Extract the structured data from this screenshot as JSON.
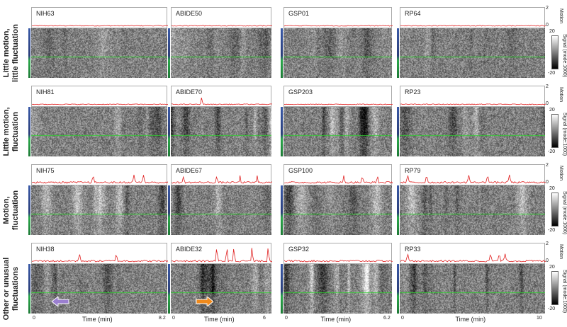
{
  "rows": [
    {
      "label_lines": [
        "Little motion,",
        "little fluctuation"
      ],
      "subjects": [
        "NIH63",
        "ABIDE50",
        "GSP01",
        "RP64"
      ],
      "spikes": [
        [],
        [],
        [],
        []
      ]
    },
    {
      "label_lines": [
        "Little motion,",
        "fluctuation"
      ],
      "subjects": [
        "NIH81",
        "ABIDE70",
        "GSP203",
        "RP23"
      ],
      "spikes": [
        [],
        [
          0.3
        ],
        [],
        []
      ]
    },
    {
      "label_lines": [
        "Motion,",
        "fluctuation"
      ],
      "subjects": [
        "NIH75",
        "ABIDE67",
        "GSP100",
        "RP79"
      ],
      "spikes": [
        [
          0.45,
          0.75,
          0.82
        ],
        [
          0.12,
          0.45,
          0.68,
          0.85
        ],
        [
          0.55,
          0.72,
          0.86
        ],
        [
          0.05,
          0.18,
          0.47,
          0.6,
          0.75
        ]
      ]
    },
    {
      "label_lines": [
        "Other or unusual",
        "fluctuations"
      ],
      "subjects": [
        "NIH38",
        "ABIDE32",
        "GSP32",
        "RP33"
      ],
      "spikes": [
        [
          0.35,
          0.62
        ],
        [
          0.45,
          0.55,
          0.62,
          0.8,
          0.96
        ],
        [],
        [
          0.05,
          0.62,
          0.68,
          0.72
        ]
      ]
    }
  ],
  "motion_axis": {
    "label": "Motion",
    "max": "2",
    "min": "0"
  },
  "signal_axis": {
    "label": "Signal (mode:1000)",
    "max": "20",
    "min": "-20"
  },
  "time_axis": {
    "label": "Time (min)",
    "ticks": [
      [
        "0",
        "8.2"
      ],
      [
        "0",
        "6"
      ],
      [
        "0",
        "6.2"
      ],
      [
        "0",
        "10"
      ]
    ]
  },
  "colors": {
    "motion_trace": "#e02020",
    "green_line": "#33cc33",
    "bar_top": "#3a5aa8",
    "bar_mid": "#2c3f7a",
    "bar_bottom": "#2aa84a",
    "arrow_purple": "#9b7fd0",
    "arrow_orange": "#f08a1c"
  },
  "annotations": [
    "purple-arrow",
    "orange-arrow"
  ]
}
